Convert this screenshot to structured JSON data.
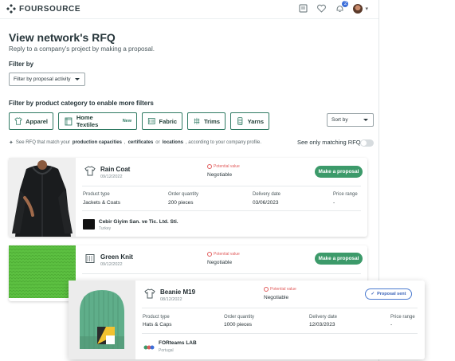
{
  "brand": {
    "name": "FOURSOURCE"
  },
  "header": {
    "notification_count": "2"
  },
  "page": {
    "title": "View network's RFQ",
    "subtitle": "Reply to a company's project by making a proposal."
  },
  "filters": {
    "filter_by_label": "Filter by",
    "proposal_select": "Filter by proposal activity",
    "category_label": "Filter by product category to enable more filters",
    "categories": [
      {
        "label": "Apparel",
        "icon": "shirt-icon"
      },
      {
        "label": "Home Textiles",
        "badge": "New",
        "icon": "towel-icon"
      },
      {
        "label": "Fabric",
        "icon": "fabric-roll-icon"
      },
      {
        "label": "Trims",
        "icon": "trims-icon"
      },
      {
        "label": "Yarns",
        "icon": "yarn-icon"
      }
    ],
    "sort_label": "Sort by",
    "hint_prefix": "See RFQ that match your",
    "hint_bold1": "production capacities",
    "hint_sep1": ",",
    "hint_bold2": "certificates",
    "hint_or": "or",
    "hint_bold3": "locations",
    "hint_suffix": ", according to your company profile.",
    "only_matching_label": "See only matching RFQ",
    "only_matching_enabled": false
  },
  "columns": {
    "product_type": "Product type",
    "order_quantity": "Order quantity",
    "delivery_date": "Delivery date",
    "price_range": "Price range"
  },
  "rfqs": [
    {
      "name": "Rain Coat",
      "date": "09/12/2022",
      "potential": "Potential value",
      "price_label": "Negotiable",
      "action": "Make a proposal",
      "product_type": "Jackets & Coats",
      "quantity": "200 pieces",
      "delivery": "03/06/2023",
      "price": "-",
      "company": "Cebir Giyim San. ve Tic. Ltd. Sti.",
      "country": "Turkey"
    },
    {
      "name": "Green Knit",
      "date": "09/12/2022",
      "potential": "Potential value",
      "price_label": "Negotiable",
      "action": "Make a proposal"
    },
    {
      "name": "Beanie M19",
      "date": "08/12/2022",
      "potential": "Potential value",
      "price_label": "Negotiable",
      "action": "Proposal sent",
      "product_type": "Hats & Caps",
      "quantity": "1000 pieces",
      "delivery": "12/03/2023",
      "price": "-",
      "company": "FORteams LAB",
      "country": "Portugal"
    }
  ],
  "colors": {
    "accent_green": "#3c9a6a",
    "sent_blue": "#3a63b8",
    "potential_red": "#e15b5b"
  }
}
